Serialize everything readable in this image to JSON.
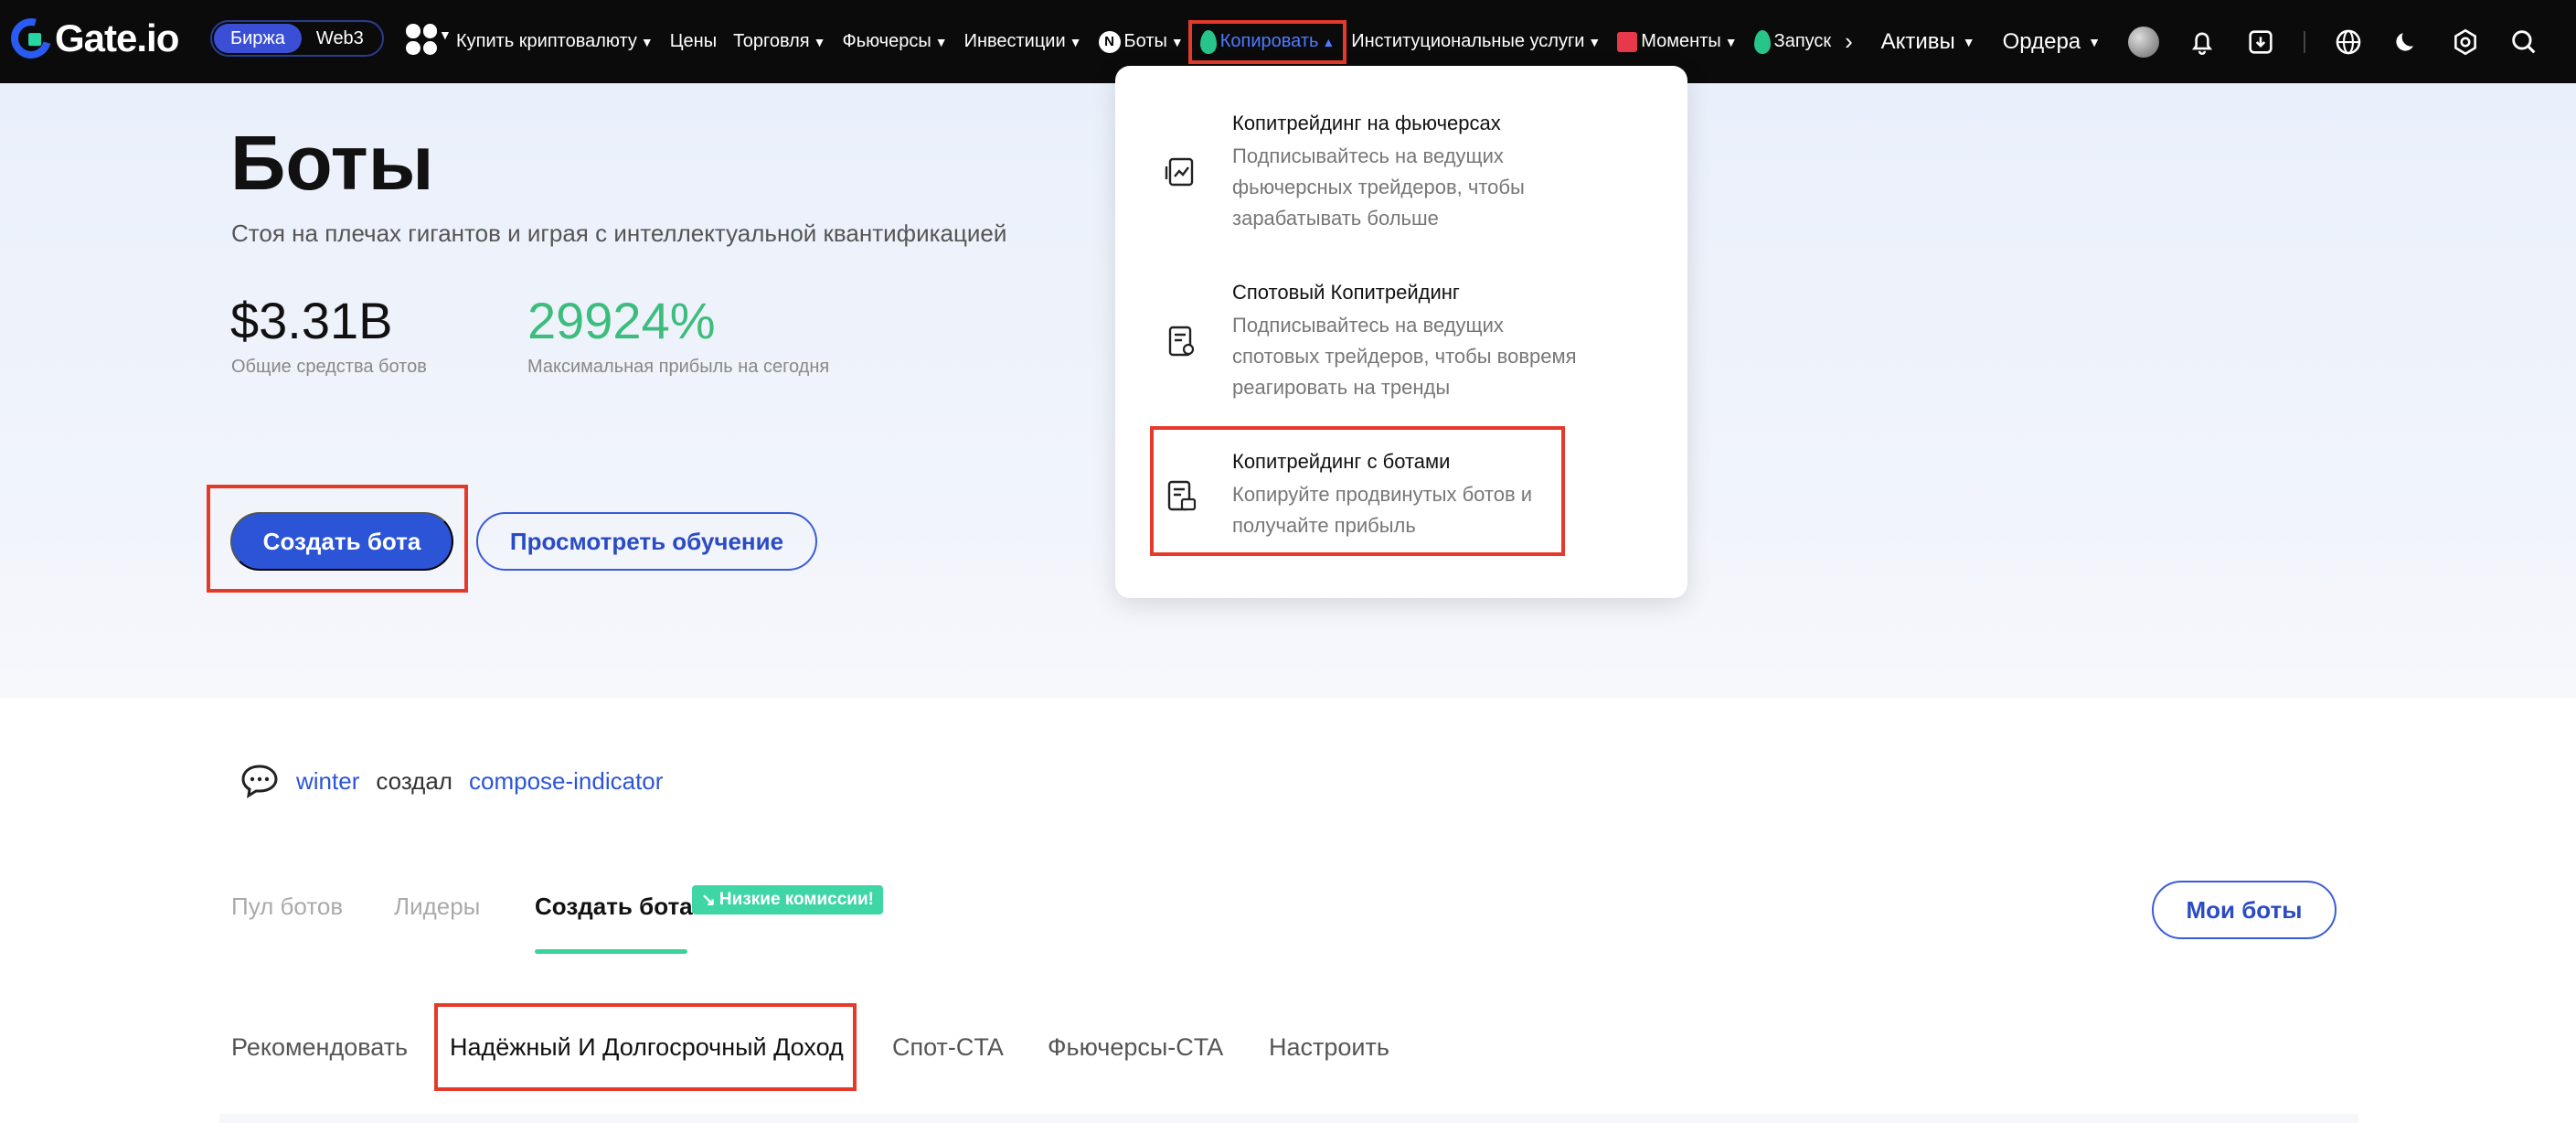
{
  "nav": {
    "brand": "Gate.io",
    "env_switch": [
      "Биржа",
      "Web3"
    ],
    "items": [
      {
        "label": "Купить криптовалюту",
        "caret": true
      },
      {
        "label": "Цены",
        "caret": false
      },
      {
        "label": "Торговля",
        "caret": true
      },
      {
        "label": "Фьючерсы",
        "caret": true
      },
      {
        "label": "Инвестиции",
        "caret": true
      },
      {
        "label": "Боты",
        "caret": true
      },
      {
        "label": "Копировать",
        "caret": true
      },
      {
        "label": "Институциональные услуги",
        "caret": true
      },
      {
        "label": "Моменты",
        "caret": true
      },
      {
        "label": "Запуск",
        "caret": false
      }
    ],
    "right": {
      "assets": "Активы",
      "orders": "Ордера"
    },
    "bots_badge": "N"
  },
  "hero": {
    "title": "Боты",
    "subtitle": "Стоя на плечах гигантов и играя с интеллектуальной квантификацией",
    "stat1_value": "$3.31B",
    "stat1_label": "Общие средства ботов",
    "stat2_value": "29924%",
    "stat2_label": "Максимальная прибыль на сегодня",
    "create_btn": "Создать бота",
    "tutorial_btn": "Просмотреть обучение"
  },
  "dropdown": {
    "items": [
      {
        "title": "Копитрейдинг на фьючерсах",
        "desc": [
          "Подписывайтесь на ведущих",
          "фьючерсных трейдеров, чтобы",
          "зарабатывать больше"
        ]
      },
      {
        "title": "Спотовый Копитрейдинг",
        "desc": [
          "Подписывайтесь на ведущих",
          "спотовых трейдеров, чтобы вовремя",
          "реагировать на тренды"
        ]
      },
      {
        "title": "Копитрейдинг с ботами",
        "desc": [
          "Копируйте продвинутых ботов и",
          "получайте прибыль"
        ]
      }
    ]
  },
  "activity": {
    "user": "winter",
    "verb": "создал",
    "bot": "compose-indicator"
  },
  "tabs": {
    "pool": "Пул ботов",
    "leaders": "Лидеры",
    "create": "Создать бота",
    "badge": "Низкие комиссии!",
    "my_bots": "Мои боты"
  },
  "subtabs": [
    "Рекомендовать",
    "Надёжный И Долгосрочный Доход",
    "Спот-CTA",
    "Фьючерсы-CTA",
    "Настроить"
  ],
  "colors": {
    "accent": "#2b55d6",
    "green": "#3dbd7d",
    "highlight": "#e53a2a"
  }
}
